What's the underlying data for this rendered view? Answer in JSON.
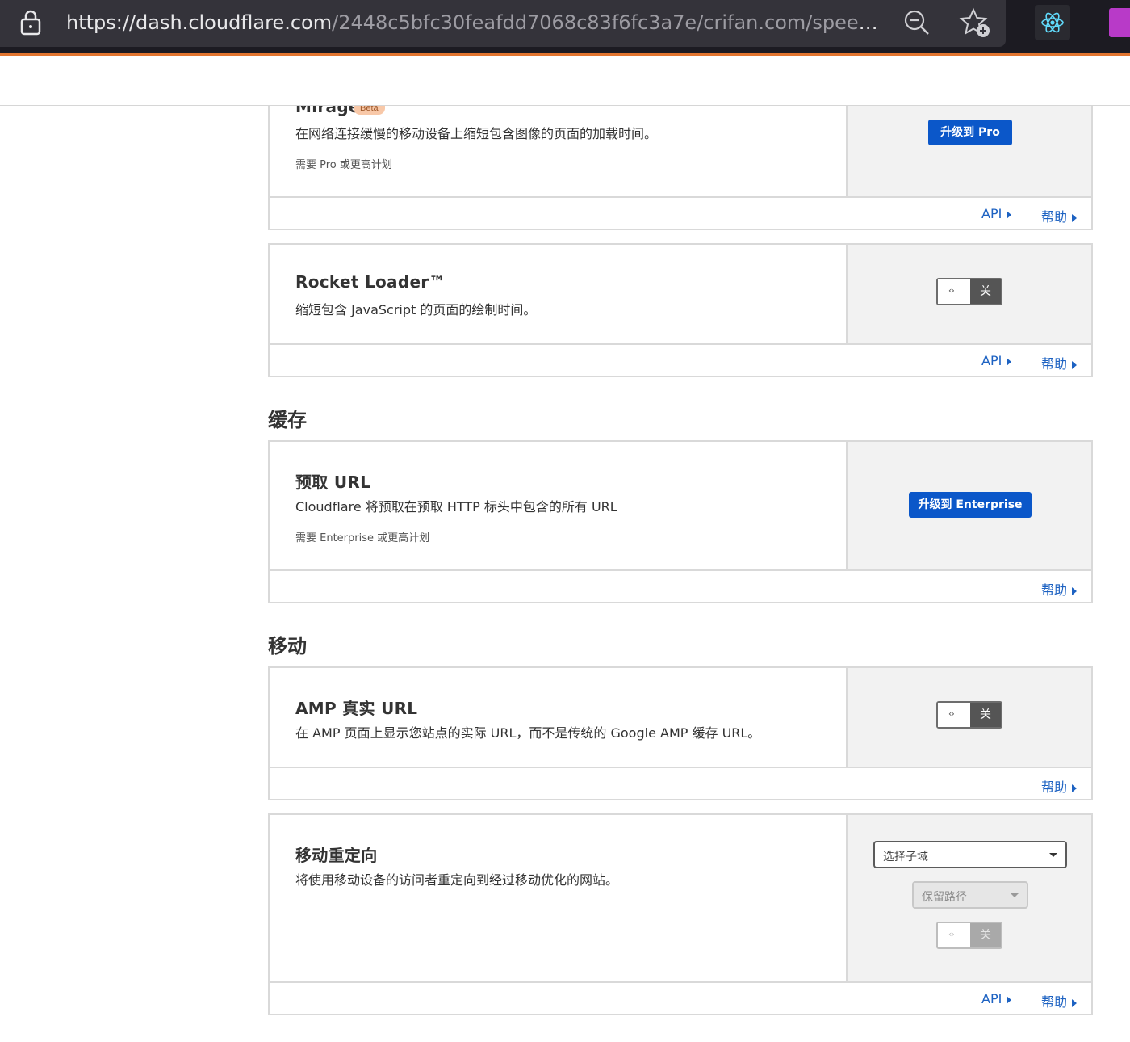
{
  "browser": {
    "url_host": "https://dash.cloudflare.com",
    "url_path": "/2448c5bfc30feafdd7068c83f6fc3a7e/crifan.com/speed/op..."
  },
  "links": {
    "api": "API",
    "help": "帮助"
  },
  "mirage": {
    "title": "Mirage",
    "badge": "Beta",
    "description": "在网络连接缓慢的移动设备上缩短包含图像的页面的加载时间。",
    "note": "需要 Pro 或更高计划",
    "button": "升级到 Pro"
  },
  "rocket_loader": {
    "title": "Rocket Loader™",
    "description": "缩短包含 JavaScript 的页面的绘制时间。",
    "toggle_knob": "‹›",
    "toggle_state": "关"
  },
  "sections": {
    "cache": "缓存",
    "mobile": "移动"
  },
  "prefetch": {
    "title": "预取 URL",
    "description": "Cloudflare 将预取在预取 HTTP 标头中包含的所有 URL",
    "note": "需要 Enterprise 或更高计划",
    "button": "升级到 Enterprise"
  },
  "amp": {
    "title": "AMP 真实 URL",
    "description": "在 AMP 页面上显示您站点的实际 URL，而不是传统的 Google AMP 缓存 URL。",
    "toggle_knob": "‹›",
    "toggle_state": "关"
  },
  "mobile_redirect": {
    "title": "移动重定向",
    "description": "将使用移动设备的访问者重定向到经过移动优化的网站。",
    "subdomain_placeholder": "选择子域",
    "path_placeholder": "保留路径",
    "toggle_knob": "‹›",
    "toggle_state": "关"
  }
}
